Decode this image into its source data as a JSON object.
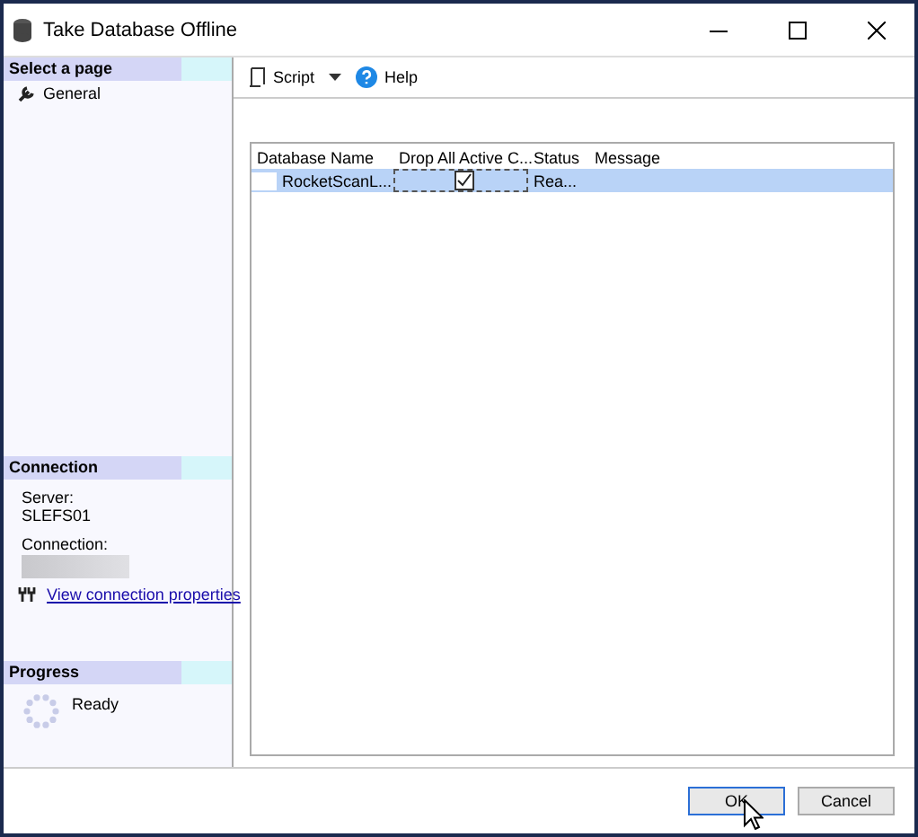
{
  "window": {
    "title": "Take Database Offline"
  },
  "sidebar": {
    "select_heading": "Select a page",
    "pages": [
      {
        "label": "General",
        "selected": true
      }
    ],
    "connection_heading": "Connection",
    "server_label": "Server:",
    "server": "SLEFS01",
    "connection_label": "Connection:",
    "link": "View connection properties",
    "progress_heading": "Progress",
    "progress_status": "Ready"
  },
  "toolbar": {
    "script": "Script",
    "help": "Help"
  },
  "table": {
    "columns": [
      "Database Name",
      "Drop All Active C...",
      "Status",
      "Message"
    ],
    "rows": [
      {
        "name": "RocketScanL...",
        "checked": true,
        "status": "Rea...",
        "message": "",
        "selected": true
      }
    ]
  },
  "buttons": [
    {
      "label": "OK",
      "kind": "default"
    },
    {
      "label": "Cancel",
      "kind": "normal"
    }
  ]
}
